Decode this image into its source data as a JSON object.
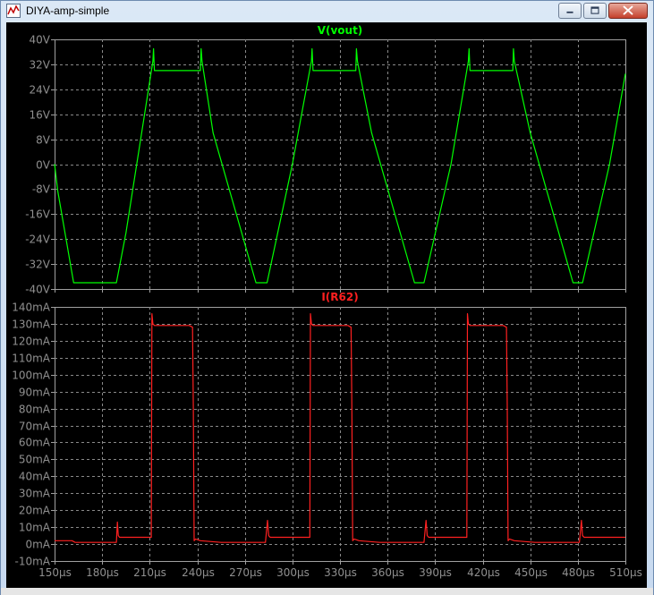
{
  "window": {
    "title": "DIYA-amp-simple",
    "icon": "waveform-icon",
    "controls": [
      "minimize-icon",
      "maximize-icon",
      "close-icon"
    ]
  },
  "colors": {
    "background": "#000000",
    "grid": "#8a8a8a",
    "frame": "#a0a0a0",
    "tick_text": "#909090",
    "vout": "#00ff00",
    "ir62": "#ff2020"
  },
  "chart_data": [
    {
      "type": "line",
      "title": "V(vout)",
      "xlabel": "",
      "ylabel": "",
      "xlim": [
        150,
        510
      ],
      "ylim": [
        -40,
        40
      ],
      "grid": true,
      "x_ticks": [
        "150µs",
        "180µs",
        "210µs",
        "240µs",
        "270µs",
        "300µs",
        "330µs",
        "360µs",
        "390µs",
        "420µs",
        "450µs",
        "480µs",
        "510µs"
      ],
      "y_ticks": [
        "40V",
        "32V",
        "24V",
        "16V",
        "8V",
        "0V",
        "-8V",
        "-16V",
        "-24V",
        "-32V",
        "-40V"
      ],
      "series": [
        {
          "name": "V(vout)",
          "color": "#00ff00",
          "unit": "V",
          "x": [
            150,
            152,
            162,
            189,
            195,
            212,
            212.4,
            213,
            242,
            242.4,
            243,
            250,
            277,
            284,
            300,
            312,
            312.4,
            313,
            340,
            340.4,
            341,
            350,
            377,
            383,
            400,
            411,
            411.4,
            412,
            439,
            439.4,
            440,
            450,
            477,
            483,
            500,
            510
          ],
          "values": [
            0,
            -8.5,
            -38,
            -38,
            -22,
            33,
            37,
            30,
            30,
            37,
            33,
            10,
            -38,
            -38,
            0,
            33,
            37,
            30,
            30,
            37,
            33,
            10,
            -38,
            -38,
            0,
            33,
            37,
            30,
            30,
            37,
            33,
            10,
            -38,
            -38,
            0,
            29
          ]
        }
      ]
    },
    {
      "type": "line",
      "title": "I(R62)",
      "xlabel": "",
      "ylabel": "",
      "xlim": [
        150,
        510
      ],
      "ylim": [
        -10,
        140
      ],
      "grid": true,
      "x_ticks": [
        "150µs",
        "180µs",
        "210µs",
        "240µs",
        "270µs",
        "300µs",
        "330µs",
        "360µs",
        "390µs",
        "420µs",
        "450µs",
        "480µs",
        "510µs"
      ],
      "y_ticks": [
        "140mA",
        "130mA",
        "120mA",
        "110mA",
        "100mA",
        "90mA",
        "80mA",
        "70mA",
        "60mA",
        "50mA",
        "40mA",
        "30mA",
        "20mA",
        "10mA",
        "0mA",
        "-10mA"
      ],
      "series": [
        {
          "name": "I(R62)",
          "color": "#ff2020",
          "unit": "mA",
          "x": [
            150,
            153,
            161,
            163,
            189,
            189.6,
            190.2,
            191,
            195,
            211,
            211.4,
            212,
            213,
            215,
            235,
            237,
            237.5,
            238,
            239,
            242,
            255,
            260,
            283,
            284.3,
            285,
            286,
            300,
            311,
            311.4,
            312,
            313,
            315,
            335,
            337,
            337.5,
            338,
            339,
            342,
            355,
            360,
            383,
            384.3,
            385,
            386,
            400,
            410,
            410.4,
            411,
            412,
            414,
            433,
            435,
            435.5,
            436,
            437,
            440,
            453,
            458,
            481,
            482.3,
            483,
            484,
            510
          ],
          "values": [
            2,
            2,
            2,
            1,
            1,
            13,
            5,
            4,
            4,
            4,
            136,
            130,
            129,
            129,
            129,
            128,
            80,
            2,
            3,
            2,
            1,
            1,
            1,
            14,
            5,
            4,
            4,
            4,
            136,
            130,
            129,
            129,
            129,
            128,
            80,
            2,
            3,
            2,
            1,
            1,
            1,
            14,
            5,
            4,
            4,
            4,
            136,
            130,
            129,
            129,
            129,
            128,
            80,
            2,
            3,
            2,
            1,
            1,
            1,
            14,
            5,
            4,
            4
          ]
        }
      ]
    }
  ]
}
